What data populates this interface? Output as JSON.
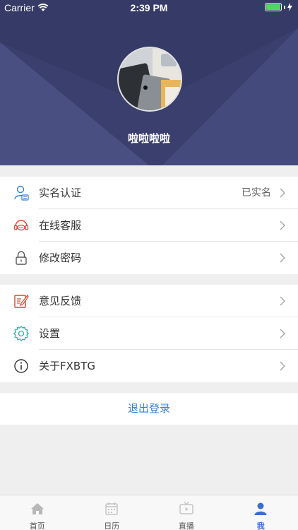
{
  "status_bar": {
    "carrier": "Carrier",
    "time": "2:39 PM"
  },
  "profile": {
    "username": "啦啦啦啦"
  },
  "menu_groups": [
    {
      "items": [
        {
          "label": "实名认证",
          "value": "已实名",
          "icon": "id-card-icon"
        },
        {
          "label": "在线客服",
          "icon": "headset-icon"
        },
        {
          "label": "修改密码",
          "icon": "lock-icon"
        }
      ]
    },
    {
      "items": [
        {
          "label": "意见反馈",
          "icon": "feedback-icon"
        },
        {
          "label": "设置",
          "icon": "gear-icon"
        },
        {
          "label": "关于FXBTG",
          "icon": "info-icon"
        }
      ]
    }
  ],
  "logout_label": "退出登录",
  "tabbar": {
    "tabs": [
      {
        "label": "首页",
        "icon": "home-icon"
      },
      {
        "label": "日历",
        "icon": "calendar-icon"
      },
      {
        "label": "直播",
        "icon": "tv-icon"
      },
      {
        "label": "我",
        "icon": "user-icon",
        "active": true
      }
    ]
  },
  "colors": {
    "header_bg": "#3b3f6e",
    "accent": "#3a7fd5",
    "battery": "#4cd964"
  }
}
